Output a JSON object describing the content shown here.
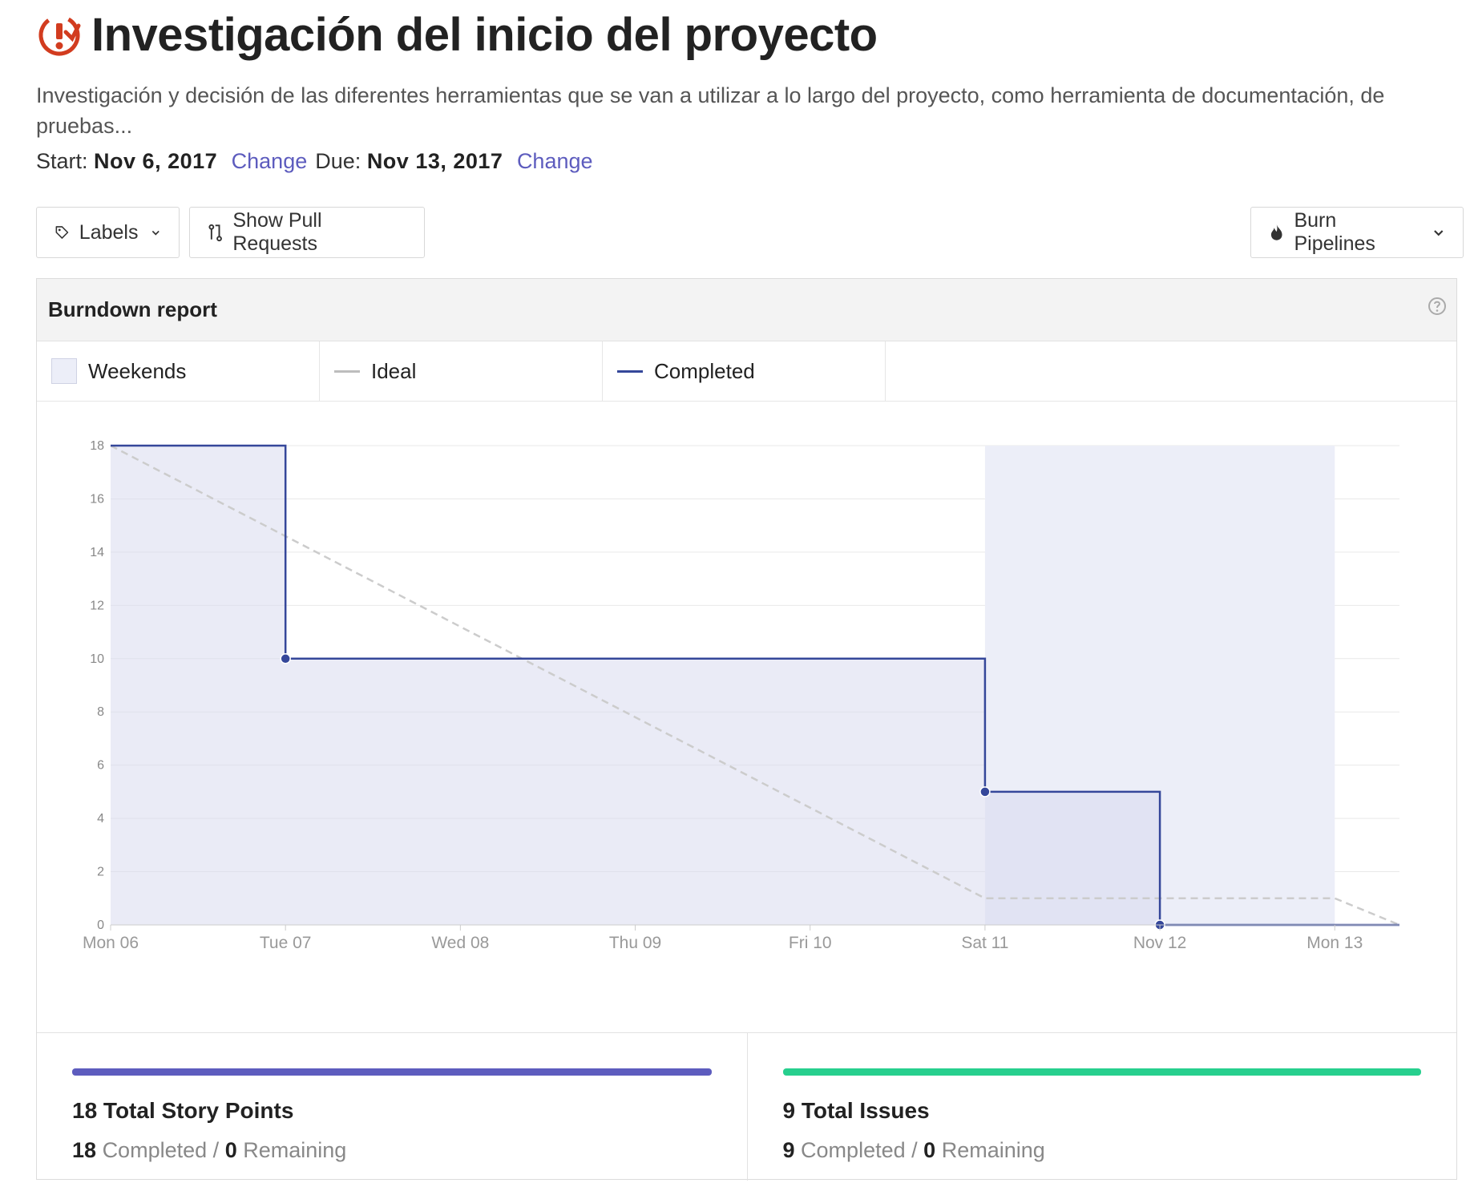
{
  "header": {
    "title": "Investigación del inicio del proyecto",
    "description": "Investigación y decisión de las diferentes herramientas que se van a utilizar a lo largo del proyecto, como herramienta de documentación, de pruebas...",
    "start_label": "Start:",
    "start_date": "Nov 6, 2017",
    "due_label": "Due:",
    "due_date": "Nov 13, 2017",
    "change_label": "Change",
    "icon": "milestone-alert-icon",
    "accent_color": "#d23c1f"
  },
  "toolbar": {
    "labels_button": "Labels",
    "pull_requests_button": "Show Pull Requests",
    "burn_pipelines_button": "Burn Pipelines"
  },
  "panel": {
    "title": "Burndown report",
    "legend": {
      "weekends": "Weekends",
      "ideal": "Ideal",
      "completed": "Completed"
    }
  },
  "chart_data": {
    "type": "line",
    "title": "",
    "xlabel": "",
    "ylabel": "",
    "x_ticks": [
      "Mon 06",
      "Tue 07",
      "Wed 08",
      "Thu 09",
      "Fri 10",
      "Sat 11",
      "Nov 12",
      "Mon 13"
    ],
    "y_ticks": [
      0,
      2,
      4,
      6,
      8,
      10,
      12,
      14,
      16,
      18
    ],
    "ylim": [
      0,
      18
    ],
    "xlim": [
      0,
      7.37
    ],
    "grid": true,
    "weekend_range": [
      5,
      7
    ],
    "series": [
      {
        "name": "Ideal",
        "style": "dashed",
        "color": "#cccccc",
        "x": [
          0,
          5,
          7,
          7.37
        ],
        "y": [
          18,
          1,
          1,
          0
        ]
      },
      {
        "name": "Completed",
        "style": "step",
        "color": "#35479a",
        "x": [
          0,
          1,
          1,
          5,
          5,
          6,
          6,
          7.37
        ],
        "y": [
          18,
          18,
          10,
          10,
          5,
          5,
          0,
          0
        ],
        "markers": [
          [
            1,
            10
          ],
          [
            5,
            5
          ],
          [
            6,
            0
          ]
        ]
      }
    ]
  },
  "stats": {
    "story_points": {
      "title": "18 Total Story Points",
      "completed": "18",
      "completed_label": "Completed",
      "sep": "/",
      "remaining": "0",
      "remaining_label": "Remaining",
      "color": "#5d5cbe"
    },
    "issues": {
      "title": "9 Total Issues",
      "completed": "9",
      "completed_label": "Completed",
      "sep": "/",
      "remaining": "0",
      "remaining_label": "Remaining",
      "color": "#27cf8e"
    }
  }
}
